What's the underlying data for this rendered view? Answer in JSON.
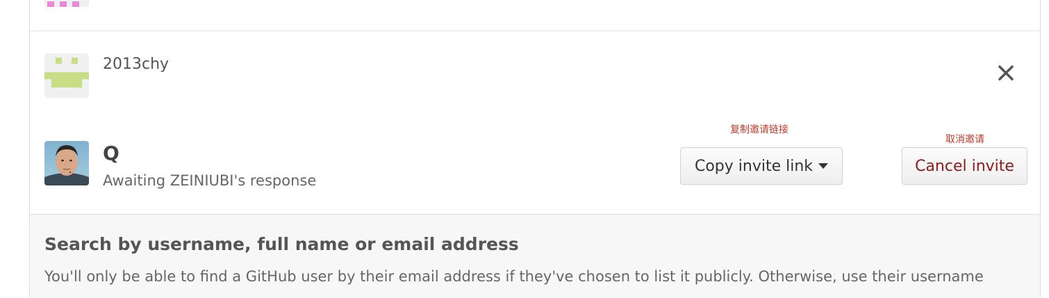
{
  "members": [
    {
      "username": "2013chy",
      "avatar_icon": "identicon-green"
    },
    {
      "display_name": "Q",
      "status": "Awaiting ZEINIUBI's response",
      "avatar_icon": "photo-avatar",
      "annotations": {
        "copy_link": "复制邀请链接",
        "cancel_invite": "取消邀请"
      },
      "actions": {
        "copy_invite_link": "Copy invite link",
        "cancel_invite": "Cancel invite"
      }
    }
  ],
  "remove_icon": "close-icon",
  "search": {
    "title": "Search by username, full name or email address",
    "description": "You'll only be able to find a GitHub user by their email address if they've chosen to list it publicly. Otherwise, use their username"
  },
  "colors": {
    "cancel_text": "#8b1a1a",
    "annotation_red": "#c0392b",
    "identicon_green": "#c7de86",
    "identicon_pink": "#e68ad6"
  }
}
